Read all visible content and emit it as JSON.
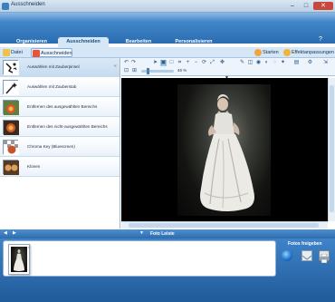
{
  "window": {
    "title": "Ausschneiden",
    "controls": {
      "minimize": "–",
      "maximize": "□",
      "close": "✕"
    }
  },
  "tabs": [
    {
      "label": "Organisieren"
    },
    {
      "label": "Ausschneiden"
    },
    {
      "label": "Bearbeiten"
    },
    {
      "label": "Personalisieren"
    }
  ],
  "subbar": {
    "datei": "Datei",
    "ausschneiden": "Ausschneiden",
    "starten": "Starten",
    "effekt": "Effektanpassungen"
  },
  "tools": [
    {
      "label": "Auswählen mit Zauberpinsel"
    },
    {
      "label": "Auswählen mit Zauberstab"
    },
    {
      "label": "Entfernen des ausgewählten Bereichs"
    },
    {
      "label": "Entfernen des nicht-ausgewählten Bereichs"
    },
    {
      "label": "Chroma Key (Bluescreen)"
    },
    {
      "label": "Klonen"
    }
  ],
  "zoom": {
    "label": "46 %"
  },
  "fotoleiste": {
    "label": "Foto Leiste"
  },
  "share": {
    "title": "Fotos freigeben"
  },
  "icons": {
    "help": "?",
    "collapse": "«",
    "prev": "◀",
    "next": "▶",
    "down": "▼",
    "film_close": "x"
  }
}
